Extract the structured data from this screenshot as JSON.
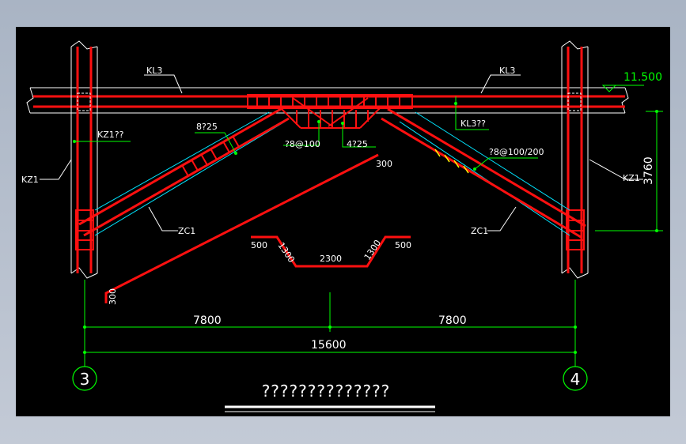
{
  "colors": {
    "background": "#000000",
    "frame": "#b5bfcc",
    "rebar": "#ff1010",
    "dimension": "#00ff00",
    "outline": "#00e5ff",
    "text": "#ffffff"
  },
  "labels": {
    "kl3_left": "KL3",
    "kl3_right": "KL3",
    "kl3_under": "KL3??",
    "elevation": "11.500",
    "kz1_q": "KZ1??",
    "kz1_left": "KZ1",
    "kz1_right": "KZ1",
    "zc1_left": "ZC1",
    "zc1_right": "ZC1",
    "bars_8_25": "8?25",
    "stirrup_center": "?8@100",
    "bars_4_25": "4?25",
    "stirrup_right": "?8@100/200",
    "height_dim": "3760"
  },
  "bar_shape": {
    "seg_300_top": "300",
    "seg_300_bottom": "300",
    "seg_500_left": "500",
    "seg_1300_left": "1300",
    "seg_2300": "2300",
    "seg_1300_right": "1300",
    "seg_500_right": "500"
  },
  "dimensions": {
    "span_left": "7800",
    "span_right": "7800",
    "span_total": "15600"
  },
  "axes": {
    "left": "3",
    "right": "4"
  },
  "title": "??????????????"
}
